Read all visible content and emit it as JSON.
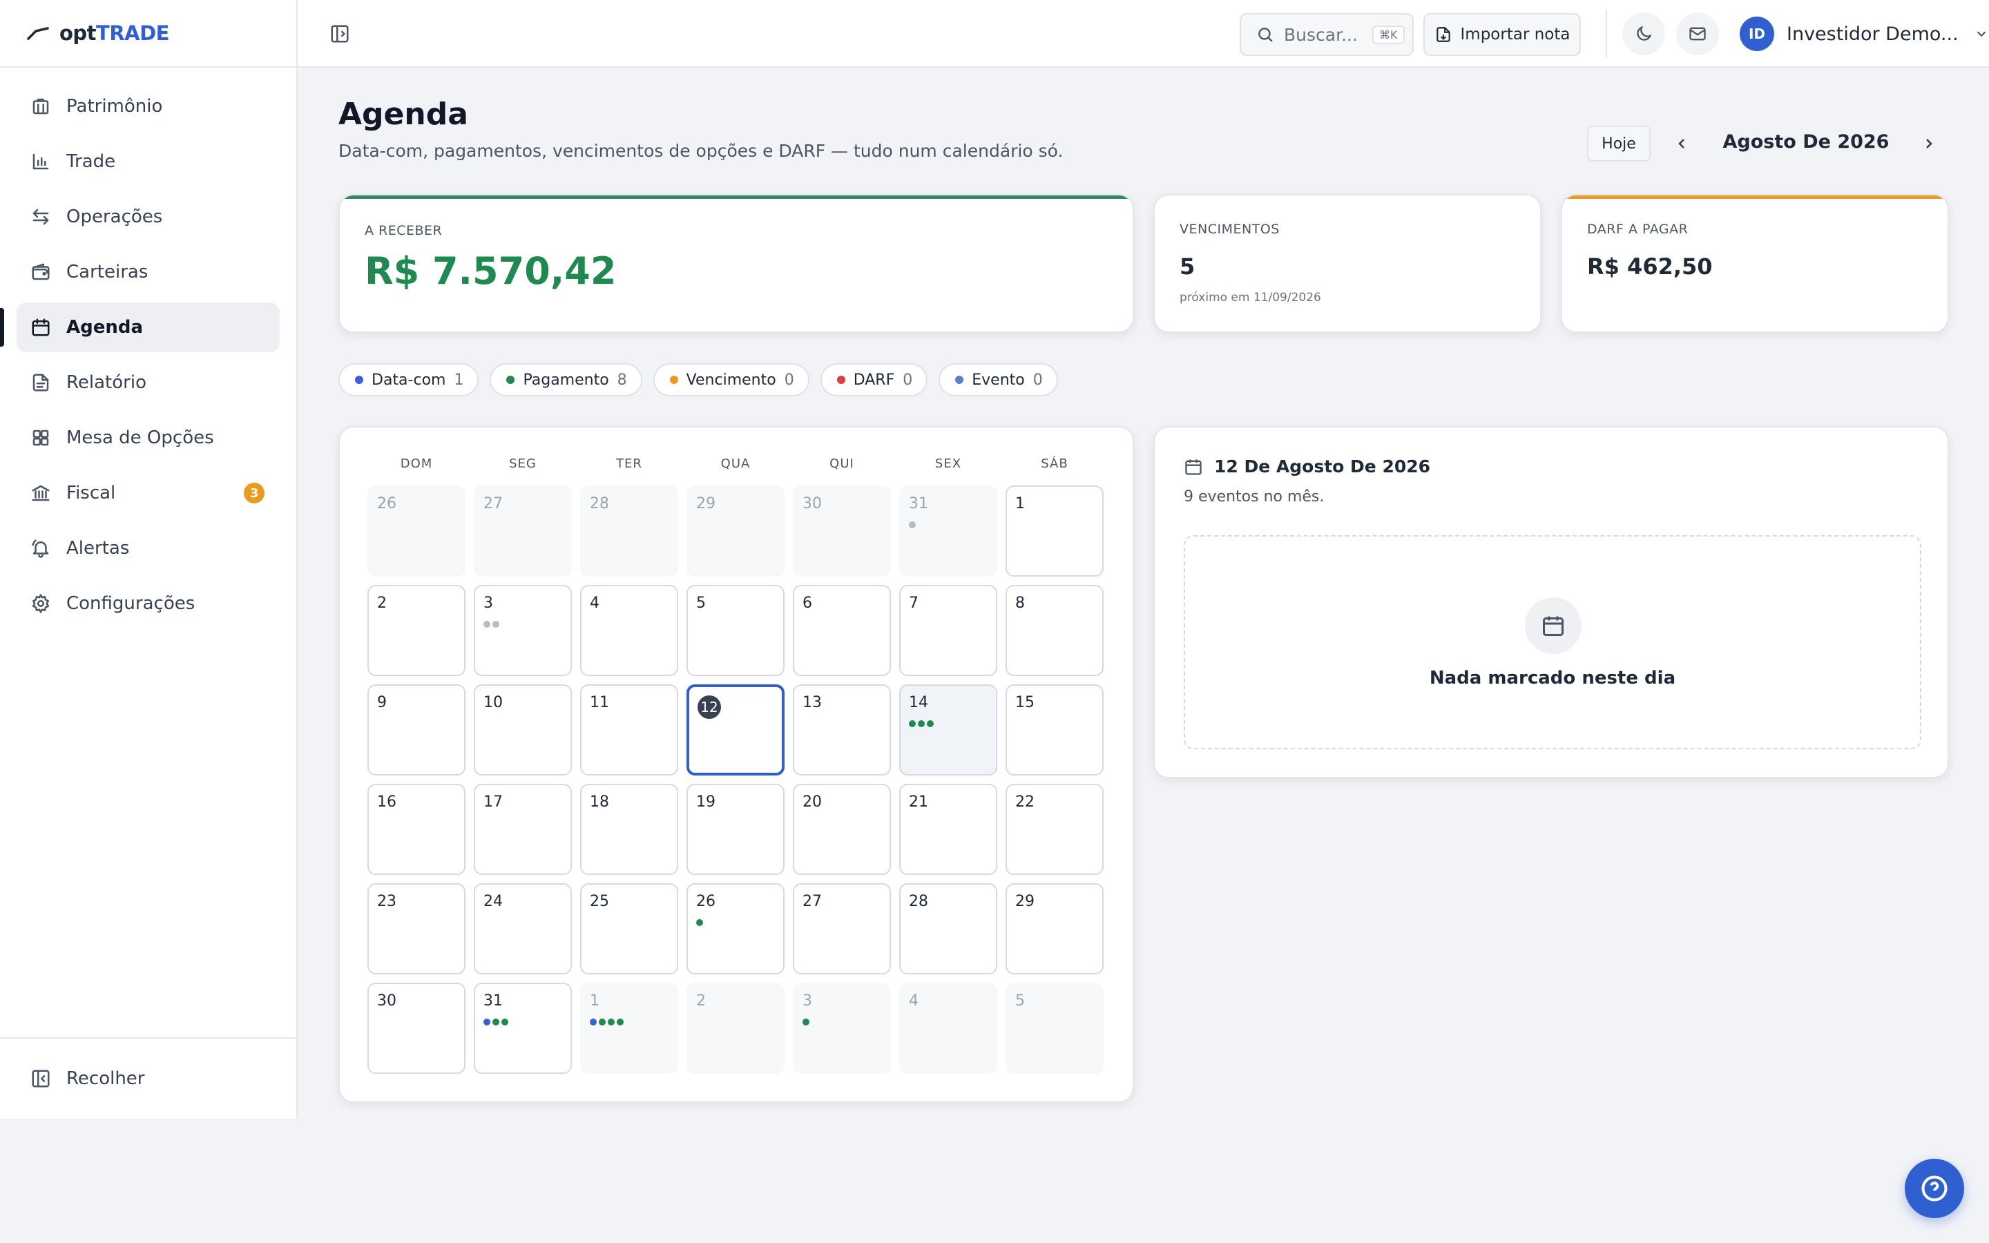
{
  "app": {
    "logo_prefix": "opt",
    "logo_suffix": "TRADE"
  },
  "sidebar": {
    "items": [
      {
        "label": "Patrimônio",
        "icon": "building-icon"
      },
      {
        "label": "Trade",
        "icon": "chart-icon"
      },
      {
        "label": "Operações",
        "icon": "arrows-swap-icon"
      },
      {
        "label": "Carteiras",
        "icon": "wallet-icon"
      },
      {
        "label": "Agenda",
        "icon": "calendar-icon",
        "active": true
      },
      {
        "label": "Relatório",
        "icon": "document-icon"
      },
      {
        "label": "Mesa de Opções",
        "icon": "grid-icon"
      },
      {
        "label": "Fiscal",
        "icon": "bank-icon",
        "badge": "3"
      },
      {
        "label": "Alertas",
        "icon": "bell-icon"
      },
      {
        "label": "Configurações",
        "icon": "gear-icon"
      }
    ],
    "collapse_label": "Recolher"
  },
  "topbar": {
    "search_placeholder": "Buscar...",
    "search_shortcut": "⌘K",
    "import_label": "Importar nota",
    "user_initials": "ID",
    "user_name": "Investidor Demo..."
  },
  "page": {
    "title": "Agenda",
    "subtitle": "Data-com, pagamentos, vencimentos de opções e DARF — tudo num calendário só.",
    "today_label": "Hoje",
    "month_label": "Agosto De 2026"
  },
  "cards": {
    "receive": {
      "label": "A RECEBER",
      "value": "R$ 7.570,42",
      "accent": "#2e8a5c"
    },
    "expirations": {
      "label": "VENCIMENTOS",
      "value": "5",
      "sub": "próximo em 11/09/2026"
    },
    "darf": {
      "label": "DARF A PAGAR",
      "value": "R$ 462,50",
      "accent": "#e99b1f"
    }
  },
  "legend": [
    {
      "label": "Data-com",
      "count": "1",
      "color": "#3b5fd4"
    },
    {
      "label": "Pagamento",
      "count": "8",
      "color": "#1f8a50"
    },
    {
      "label": "Vencimento",
      "count": "0",
      "color": "#e99b1f"
    },
    {
      "label": "DARF",
      "count": "0",
      "color": "#d9423b"
    },
    {
      "label": "Evento",
      "count": "0",
      "color": "#5b7fd6"
    }
  ],
  "calendar": {
    "weekdays": [
      "DOM",
      "SEG",
      "TER",
      "QUA",
      "QUI",
      "SEX",
      "SÁB"
    ],
    "weeks": [
      [
        {
          "d": "26",
          "out": true
        },
        {
          "d": "27",
          "out": true
        },
        {
          "d": "28",
          "out": true
        },
        {
          "d": "29",
          "out": true
        },
        {
          "d": "30",
          "out": true
        },
        {
          "d": "31",
          "out": true,
          "dots": [
            "#b7bcc4"
          ]
        },
        {
          "d": "1"
        }
      ],
      [
        {
          "d": "2"
        },
        {
          "d": "3",
          "dots": [
            "#b7bcc4",
            "#b7bcc4"
          ]
        },
        {
          "d": "4"
        },
        {
          "d": "5"
        },
        {
          "d": "6"
        },
        {
          "d": "7"
        },
        {
          "d": "8"
        }
      ],
      [
        {
          "d": "9"
        },
        {
          "d": "10"
        },
        {
          "d": "11"
        },
        {
          "d": "12",
          "today": true
        },
        {
          "d": "13"
        },
        {
          "d": "14",
          "highlight": true,
          "dots": [
            "#1f8a50",
            "#1f8a50",
            "#1f8a50"
          ]
        },
        {
          "d": "15"
        }
      ],
      [
        {
          "d": "16"
        },
        {
          "d": "17"
        },
        {
          "d": "18"
        },
        {
          "d": "19"
        },
        {
          "d": "20"
        },
        {
          "d": "21"
        },
        {
          "d": "22"
        }
      ],
      [
        {
          "d": "23"
        },
        {
          "d": "24"
        },
        {
          "d": "25"
        },
        {
          "d": "26",
          "dots": [
            "#1f8a50"
          ]
        },
        {
          "d": "27"
        },
        {
          "d": "28"
        },
        {
          "d": "29"
        }
      ],
      [
        {
          "d": "30"
        },
        {
          "d": "31",
          "dots": [
            "#3b5fd4",
            "#1f8a50",
            "#1f8a50"
          ]
        },
        {
          "d": "1",
          "out": true,
          "dots": [
            "#3b5fd4",
            "#1f8a50",
            "#1f8a50",
            "#1f8a50"
          ]
        },
        {
          "d": "2",
          "out": true
        },
        {
          "d": "3",
          "out": true,
          "dots": [
            "#1f8a50"
          ]
        },
        {
          "d": "4",
          "out": true
        },
        {
          "d": "5",
          "out": true
        }
      ]
    ]
  },
  "detail": {
    "date": "12 De Agosto De 2026",
    "sub": "9 eventos no mês.",
    "empty": "Nada marcado neste dia"
  }
}
